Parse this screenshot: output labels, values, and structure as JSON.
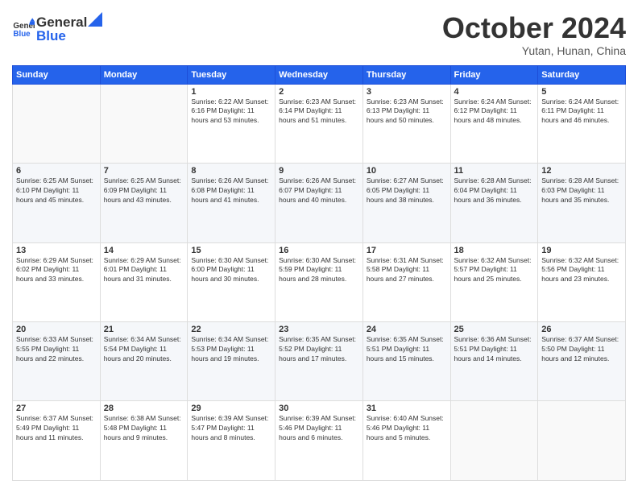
{
  "logo": {
    "line1": "General",
    "line2": "Blue"
  },
  "header": {
    "month": "October 2024",
    "location": "Yutan, Hunan, China"
  },
  "weekdays": [
    "Sunday",
    "Monday",
    "Tuesday",
    "Wednesday",
    "Thursday",
    "Friday",
    "Saturday"
  ],
  "weeks": [
    [
      {
        "day": "",
        "info": ""
      },
      {
        "day": "",
        "info": ""
      },
      {
        "day": "1",
        "info": "Sunrise: 6:22 AM\nSunset: 6:16 PM\nDaylight: 11 hours and 53 minutes."
      },
      {
        "day": "2",
        "info": "Sunrise: 6:23 AM\nSunset: 6:14 PM\nDaylight: 11 hours and 51 minutes."
      },
      {
        "day": "3",
        "info": "Sunrise: 6:23 AM\nSunset: 6:13 PM\nDaylight: 11 hours and 50 minutes."
      },
      {
        "day": "4",
        "info": "Sunrise: 6:24 AM\nSunset: 6:12 PM\nDaylight: 11 hours and 48 minutes."
      },
      {
        "day": "5",
        "info": "Sunrise: 6:24 AM\nSunset: 6:11 PM\nDaylight: 11 hours and 46 minutes."
      }
    ],
    [
      {
        "day": "6",
        "info": "Sunrise: 6:25 AM\nSunset: 6:10 PM\nDaylight: 11 hours and 45 minutes."
      },
      {
        "day": "7",
        "info": "Sunrise: 6:25 AM\nSunset: 6:09 PM\nDaylight: 11 hours and 43 minutes."
      },
      {
        "day": "8",
        "info": "Sunrise: 6:26 AM\nSunset: 6:08 PM\nDaylight: 11 hours and 41 minutes."
      },
      {
        "day": "9",
        "info": "Sunrise: 6:26 AM\nSunset: 6:07 PM\nDaylight: 11 hours and 40 minutes."
      },
      {
        "day": "10",
        "info": "Sunrise: 6:27 AM\nSunset: 6:05 PM\nDaylight: 11 hours and 38 minutes."
      },
      {
        "day": "11",
        "info": "Sunrise: 6:28 AM\nSunset: 6:04 PM\nDaylight: 11 hours and 36 minutes."
      },
      {
        "day": "12",
        "info": "Sunrise: 6:28 AM\nSunset: 6:03 PM\nDaylight: 11 hours and 35 minutes."
      }
    ],
    [
      {
        "day": "13",
        "info": "Sunrise: 6:29 AM\nSunset: 6:02 PM\nDaylight: 11 hours and 33 minutes."
      },
      {
        "day": "14",
        "info": "Sunrise: 6:29 AM\nSunset: 6:01 PM\nDaylight: 11 hours and 31 minutes."
      },
      {
        "day": "15",
        "info": "Sunrise: 6:30 AM\nSunset: 6:00 PM\nDaylight: 11 hours and 30 minutes."
      },
      {
        "day": "16",
        "info": "Sunrise: 6:30 AM\nSunset: 5:59 PM\nDaylight: 11 hours and 28 minutes."
      },
      {
        "day": "17",
        "info": "Sunrise: 6:31 AM\nSunset: 5:58 PM\nDaylight: 11 hours and 27 minutes."
      },
      {
        "day": "18",
        "info": "Sunrise: 6:32 AM\nSunset: 5:57 PM\nDaylight: 11 hours and 25 minutes."
      },
      {
        "day": "19",
        "info": "Sunrise: 6:32 AM\nSunset: 5:56 PM\nDaylight: 11 hours and 23 minutes."
      }
    ],
    [
      {
        "day": "20",
        "info": "Sunrise: 6:33 AM\nSunset: 5:55 PM\nDaylight: 11 hours and 22 minutes."
      },
      {
        "day": "21",
        "info": "Sunrise: 6:34 AM\nSunset: 5:54 PM\nDaylight: 11 hours and 20 minutes."
      },
      {
        "day": "22",
        "info": "Sunrise: 6:34 AM\nSunset: 5:53 PM\nDaylight: 11 hours and 19 minutes."
      },
      {
        "day": "23",
        "info": "Sunrise: 6:35 AM\nSunset: 5:52 PM\nDaylight: 11 hours and 17 minutes."
      },
      {
        "day": "24",
        "info": "Sunrise: 6:35 AM\nSunset: 5:51 PM\nDaylight: 11 hours and 15 minutes."
      },
      {
        "day": "25",
        "info": "Sunrise: 6:36 AM\nSunset: 5:51 PM\nDaylight: 11 hours and 14 minutes."
      },
      {
        "day": "26",
        "info": "Sunrise: 6:37 AM\nSunset: 5:50 PM\nDaylight: 11 hours and 12 minutes."
      }
    ],
    [
      {
        "day": "27",
        "info": "Sunrise: 6:37 AM\nSunset: 5:49 PM\nDaylight: 11 hours and 11 minutes."
      },
      {
        "day": "28",
        "info": "Sunrise: 6:38 AM\nSunset: 5:48 PM\nDaylight: 11 hours and 9 minutes."
      },
      {
        "day": "29",
        "info": "Sunrise: 6:39 AM\nSunset: 5:47 PM\nDaylight: 11 hours and 8 minutes."
      },
      {
        "day": "30",
        "info": "Sunrise: 6:39 AM\nSunset: 5:46 PM\nDaylight: 11 hours and 6 minutes."
      },
      {
        "day": "31",
        "info": "Sunrise: 6:40 AM\nSunset: 5:46 PM\nDaylight: 11 hours and 5 minutes."
      },
      {
        "day": "",
        "info": ""
      },
      {
        "day": "",
        "info": ""
      }
    ]
  ]
}
